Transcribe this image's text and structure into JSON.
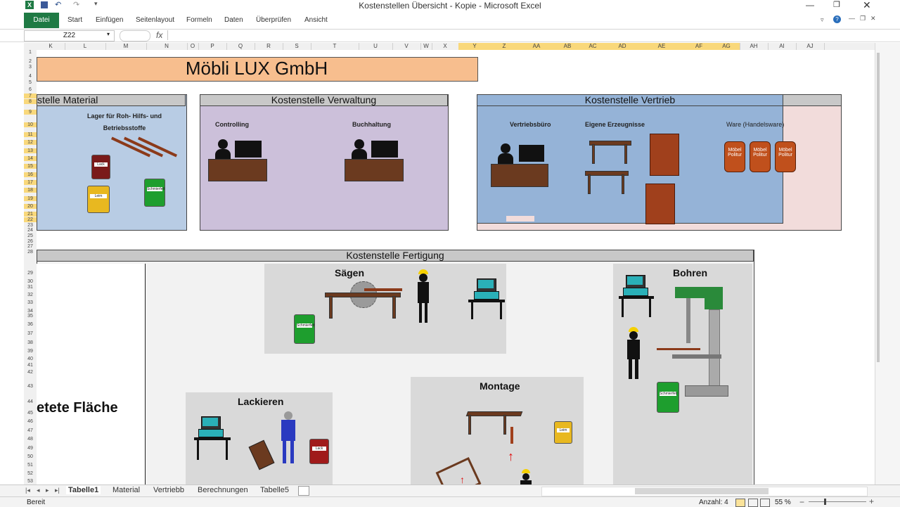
{
  "window": {
    "title": "Kostenstellen Übersicht - Kopie - Microsoft Excel"
  },
  "ribbon": {
    "file": "Datei",
    "tabs": [
      "Start",
      "Einfügen",
      "Seitenlayout",
      "Formeln",
      "Daten",
      "Überprüfen",
      "Ansicht"
    ]
  },
  "formula_bar": {
    "name_box": "Z22",
    "fx": "fx",
    "value": ""
  },
  "columns": [
    "K",
    "L",
    "M",
    "N",
    "O",
    "P",
    "Q",
    "R",
    "S",
    "T",
    "U",
    "V",
    "W",
    "X",
    "Y",
    "Z",
    "AA",
    "AB",
    "AC",
    "AD",
    "AE",
    "AF",
    "AG",
    "AH",
    "AI",
    "AJ"
  ],
  "rows": [
    "1",
    "2",
    "3",
    "4",
    "5",
    "6",
    "7",
    "8",
    "9",
    "10",
    "11",
    "12",
    "13",
    "14",
    "15",
    "16",
    "17",
    "18",
    "19",
    "20",
    "21",
    "22",
    "23",
    "24",
    "25",
    "26",
    "27",
    "28",
    "29",
    "30",
    "31",
    "32",
    "33",
    "34",
    "35",
    "36",
    "37",
    "38",
    "39",
    "40",
    "41",
    "42",
    "43",
    "44",
    "45",
    "46",
    "47",
    "48",
    "49",
    "50",
    "51",
    "52",
    "53"
  ],
  "sheet": {
    "company_title": "Möbli LUX GmbH",
    "material": {
      "header": "stelle Material",
      "label": "Lager für Roh- Hilfs- und Betriebsstoffe",
      "cans": [
        "Lack",
        "Leim",
        "Schmierfett"
      ]
    },
    "verwaltung": {
      "header": "Kostenstelle Verwaltung",
      "labels": [
        "Controlling",
        "Buchhaltung"
      ]
    },
    "vertrieb": {
      "header": "Kostenstelle Vertrieb",
      "labels": [
        "Vertriebsbüro",
        "Eigene Erzeugnisse",
        "Ware (Handelsware)"
      ],
      "bottles": [
        "Möbel Politur",
        "Möbel Politur",
        "Möbel Politur"
      ]
    },
    "fertigung": {
      "header": "Kostenstelle Fertigung",
      "left_label": "etete Fläche",
      "stations": [
        "Sägen",
        "Bohren",
        "Lackieren",
        "Montage"
      ],
      "cans": [
        "Schmierfett",
        "Schmierfett",
        "Lack",
        "Leim"
      ]
    }
  },
  "sheet_tabs": [
    "Tabelle1",
    "Material",
    "Vertriebb",
    "Berechnungen",
    "Tabelle5"
  ],
  "status": {
    "ready": "Bereit",
    "count": "Anzahl: 4",
    "zoom": "55 %"
  },
  "colors": {
    "excel_green": "#1f7a44",
    "title_orange": "#f7be8e",
    "material_blue": "#b8cce4",
    "verwaltung_purple": "#ccc0da",
    "vertrieb_blue": "#95b3d7",
    "vertrieb_pink": "#f2dcdb"
  }
}
